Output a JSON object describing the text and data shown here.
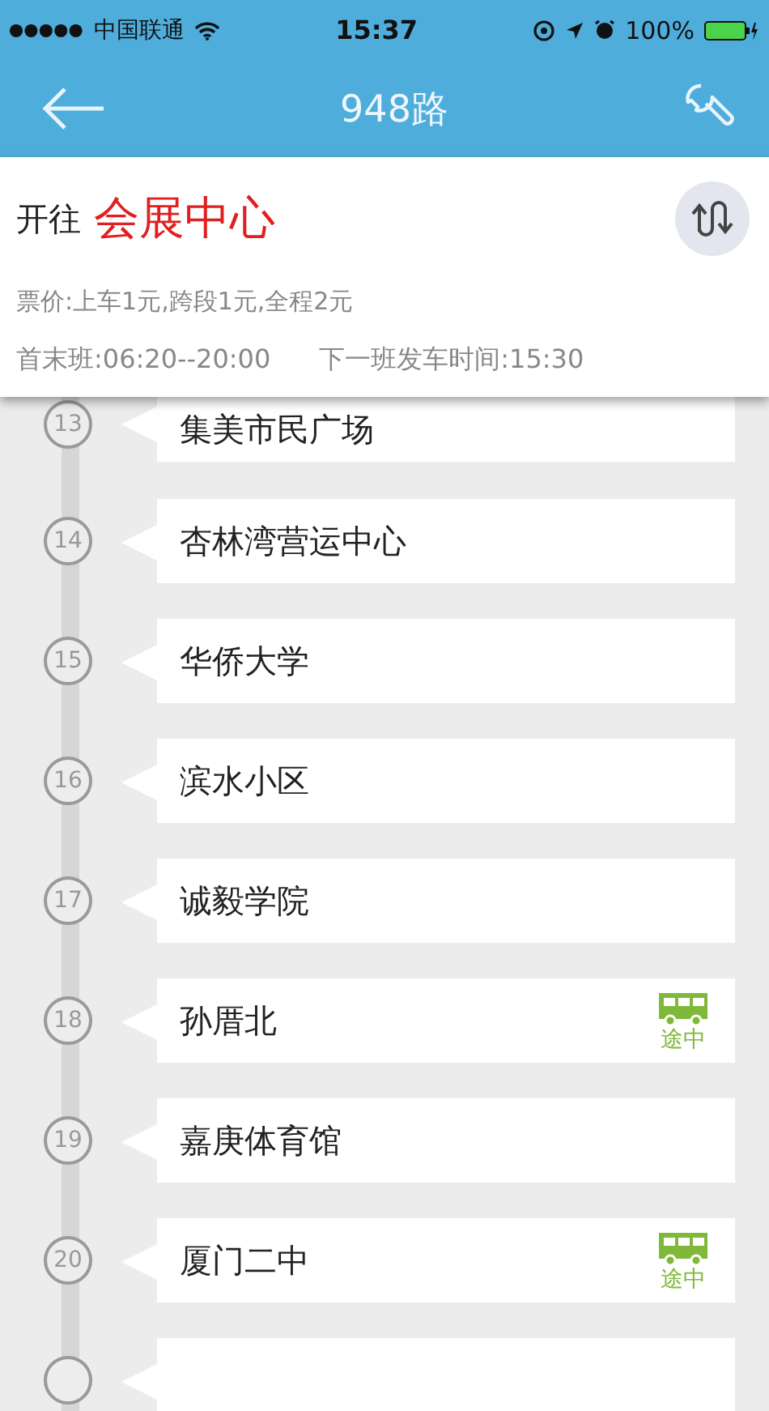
{
  "status_bar": {
    "carrier": "中国联通",
    "time": "15:37",
    "battery_text": "100%"
  },
  "nav": {
    "title": "948路"
  },
  "header": {
    "direction_label": "开往",
    "destination": "会展中心",
    "fare": "票价:上车1元,跨段1元,全程2元",
    "schedule": "首末班:06:20--20:00",
    "next_departure": "下一班发车时间:15:30"
  },
  "stops": [
    {
      "number": "13",
      "name": "集美市民广场"
    },
    {
      "number": "14",
      "name": "杏林湾营运中心"
    },
    {
      "number": "15",
      "name": "华侨大学"
    },
    {
      "number": "16",
      "name": "滨水小区"
    },
    {
      "number": "17",
      "name": "诚毅学院"
    },
    {
      "number": "18",
      "name": "孙厝北",
      "bus": {
        "label": "途中"
      }
    },
    {
      "number": "19",
      "name": "嘉庚体育馆"
    },
    {
      "number": "20",
      "name": "厦门二中",
      "bus": {
        "label": "途中"
      }
    }
  ]
}
